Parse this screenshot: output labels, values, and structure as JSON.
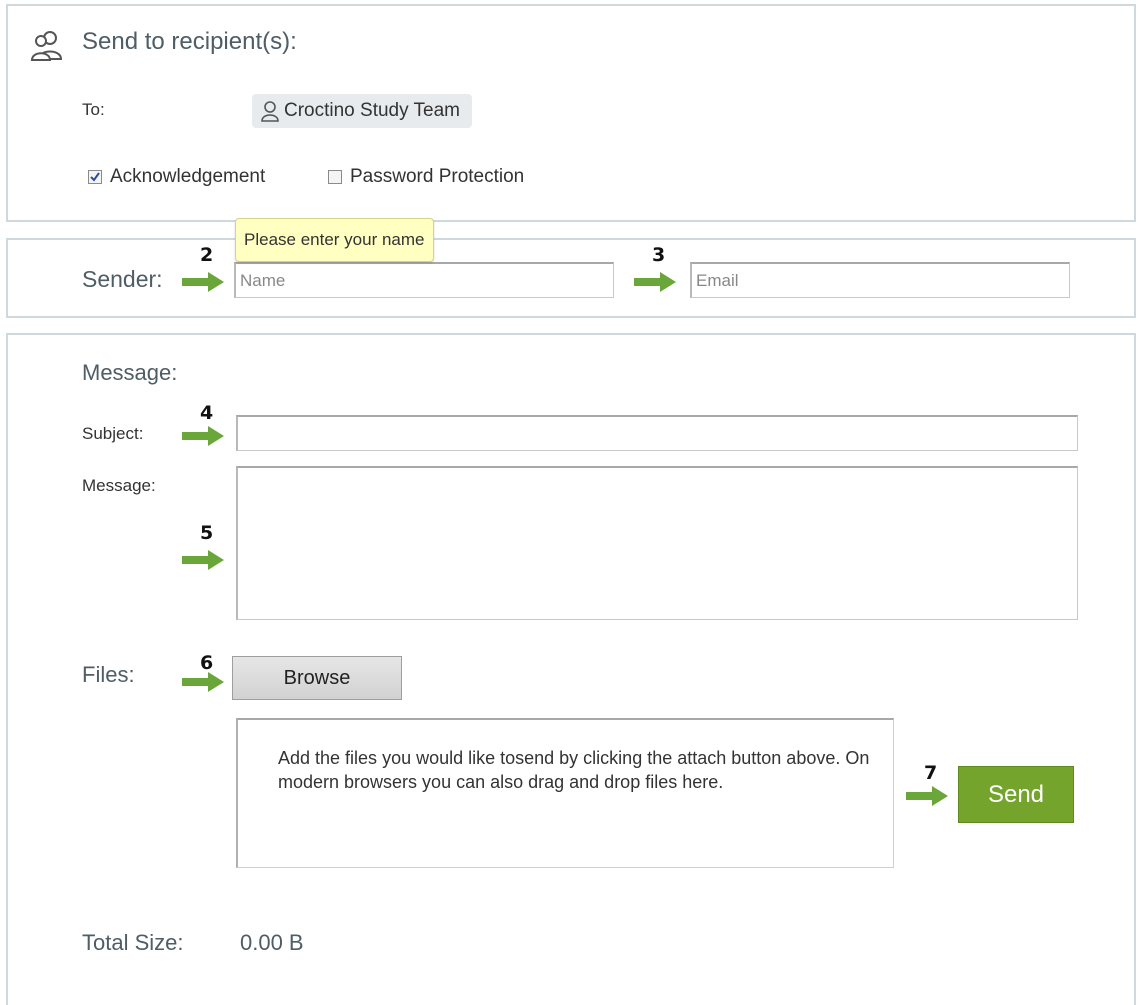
{
  "recipients": {
    "title": "Send to recipient(s):",
    "title_icon": "people-icon",
    "to_label": "To:",
    "recipient_chip": {
      "icon": "person-icon",
      "name": "Croctino Study Team"
    },
    "acknowledgement": {
      "label": "Acknowledgement",
      "checked": true
    },
    "password_protection": {
      "label": "Password Protection",
      "checked": false
    }
  },
  "sender": {
    "label": "Sender:",
    "tooltip": "Please enter your name",
    "name_placeholder": "Name",
    "email_placeholder": "Email",
    "name_step": "2",
    "email_step": "3"
  },
  "message": {
    "heading": "Message:",
    "subject_label": "Subject:",
    "subject_step": "4",
    "subject_value": "",
    "message_label": "Message:",
    "message_step": "5",
    "message_value": "",
    "files_label": "Files:",
    "files_step": "6",
    "browse_label": "Browse",
    "dropzone_text": "Add the files you would like tosend by clicking the attach button above. On modern browsers you can also drag and drop files here.",
    "send_step": "7",
    "send_label": "Send",
    "total_size_label": "Total Size:",
    "total_size_value": "0.00 B"
  },
  "colors": {
    "arrow": "#6aa63a",
    "send_button": "#74a42b",
    "tooltip_bg": "#ffffc2",
    "panel_border": "#cfd8dc"
  }
}
